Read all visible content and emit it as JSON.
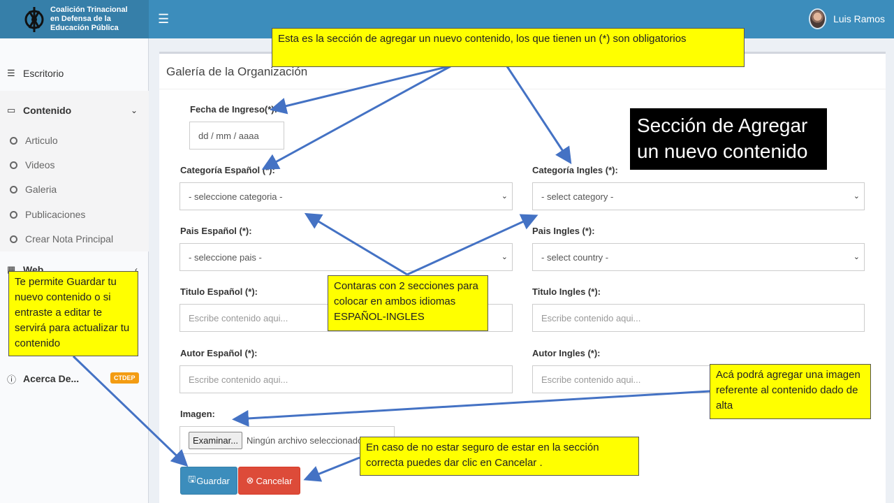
{
  "header": {
    "logo_lines": [
      "Coalición Trinacional",
      "en Defensa de la",
      "Educación Pública"
    ],
    "menu_icon": "hamburger-icon",
    "user_name": "Luis Ramos"
  },
  "sidebar": {
    "items": [
      {
        "label": "Escritorio",
        "icon": "dashboard-icon"
      },
      {
        "label": "Contenido",
        "icon": "laptop-icon"
      },
      {
        "label": "Web",
        "icon": "grid-icon"
      },
      {
        "label": "Acerca De...",
        "icon": "info-icon",
        "badge": "CTDEP"
      }
    ],
    "subitems": [
      "Articulo",
      "Videos",
      "Galeria",
      "Publicaciones",
      "Crear Nota Principal"
    ]
  },
  "form": {
    "box_title": "Galería de la Organización",
    "fecha_label": "Fecha de Ingreso(*):",
    "fecha_placeholder": "dd / mm / aaaa",
    "cat_es_label": "Categoría Español (*):",
    "cat_es_value": "- seleccione categoria -",
    "cat_en_label": "Categoría Ingles (*):",
    "cat_en_value": "- select category -",
    "pais_es_label": "Pais Español (*):",
    "pais_es_value": "- seleccione pais -",
    "pais_en_label": "Pais Ingles (*):",
    "pais_en_value": "- select country -",
    "titulo_es_label": "Titulo Español (*):",
    "titulo_en_label": "Titulo Ingles (*):",
    "autor_es_label": "Autor Español (*):",
    "autor_en_label": "Autor Ingles (*):",
    "text_placeholder": "Escribe contenido aqui...",
    "imagen_label": "Imagen:",
    "browse_label": "Examinar...",
    "file_status": "Ningún archivo seleccionado.",
    "save_label": "Guardar",
    "cancel_label": "Cancelar"
  },
  "annotations": {
    "top_note": "Esta es la sección de agregar un nuevo contenido, los que tienen un (*) son obligatorios",
    "title_card": "Sección de Agregar un nuevo contenido",
    "languages_note": "Contaras con 2 secciones para colocar en ambos idiomas ESPAÑOL-INGLES",
    "save_note": "Te permite Guardar tu nuevo contenido o si entraste a editar te servirá para actualizar tu contenido",
    "image_note": "Acá podrá agregar una imagen referente al contenido dado de alta",
    "cancel_note": "En caso de no estar seguro de estar en la sección correcta puedes dar clic en Cancelar ."
  },
  "colors": {
    "header": "#3c8dbc",
    "logo_bg": "#367fa9",
    "save": "#3c8dbc",
    "cancel": "#dd4b39",
    "note_bg": "#ffff00",
    "arrow": "#4472c4",
    "badge": "#f39c12"
  }
}
